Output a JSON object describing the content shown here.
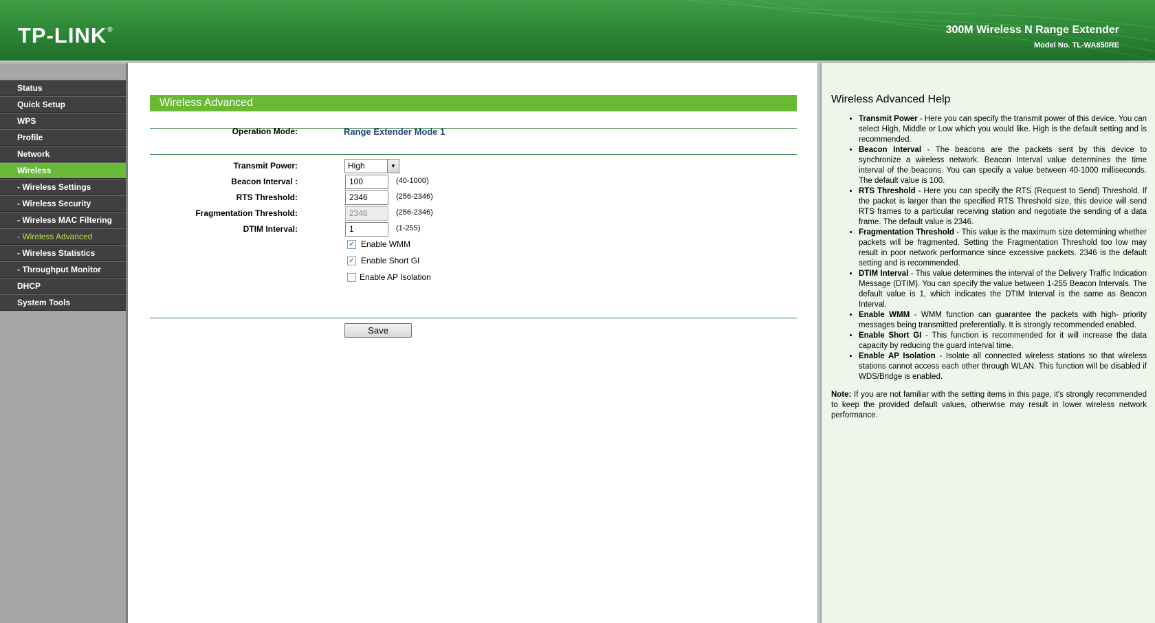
{
  "header": {
    "logo": "TP-LINK",
    "logo_mark": "®",
    "product_title": "300M Wireless N Range Extender",
    "model_no": "Model No. TL-WA850RE"
  },
  "sidebar": {
    "items": [
      {
        "label": "Status"
      },
      {
        "label": "Quick Setup"
      },
      {
        "label": "WPS"
      },
      {
        "label": "Profile"
      },
      {
        "label": "Network"
      },
      {
        "label": "Wireless"
      },
      {
        "label": "- Wireless Settings"
      },
      {
        "label": "- Wireless Security"
      },
      {
        "label": "- Wireless MAC Filtering"
      },
      {
        "label": "- Wireless Advanced"
      },
      {
        "label": "- Wireless Statistics"
      },
      {
        "label": "- Throughput Monitor"
      },
      {
        "label": "DHCP"
      },
      {
        "label": "System Tools"
      }
    ]
  },
  "main": {
    "section_title": "Wireless Advanced",
    "operation_mode": {
      "label": "Operation Mode:",
      "value": "Range Extender Mode 1"
    },
    "transmit_power": {
      "label": "Transmit Power:",
      "value": "High"
    },
    "beacon_interval": {
      "label": "Beacon Interval :",
      "value": "100",
      "hint": "(40-1000)"
    },
    "rts_threshold": {
      "label": "RTS Threshold:",
      "value": "2346",
      "hint": "(256-2346)"
    },
    "fragmentation_threshold": {
      "label": "Fragmentation Threshold:",
      "value": "2346",
      "hint": "(256-2346)"
    },
    "dtim_interval": {
      "label": "DTIM Interval:",
      "value": "1",
      "hint": "(1-255)"
    },
    "enable_wmm": {
      "label": "Enable WMM",
      "checked": true
    },
    "enable_short_gi": {
      "label": "Enable Short GI",
      "checked": true
    },
    "enable_ap_isolation": {
      "label": "Enable AP Isolation",
      "checked": false
    },
    "save_label": "Save"
  },
  "help": {
    "title": "Wireless Advanced Help",
    "items": [
      {
        "term": "Transmit Power",
        "text": " - Here you can specify the transmit power of this device. You can select High, Middle or Low which you would like. High is the default setting and is recommended."
      },
      {
        "term": "Beacon Interval",
        "text": " - The beacons are the packets sent by this device to synchronize a wireless network. Beacon Interval value determines the time interval of the beacons. You can specify a value between 40-1000 milliseconds. The default value is 100."
      },
      {
        "term": "RTS Threshold",
        "text": " - Here you can specify the RTS (Request to Send) Threshold. If the packet is larger than the specified RTS Threshold size, this device will send RTS frames to a particular receiving station and negotiate the sending of a data frame. The default value is 2346."
      },
      {
        "term": "Fragmentation Threshold",
        "text": " - This value is the maximum size determining whether packets will be fragmented. Setting the Fragmentation Threshold too low may result in poor network performance since excessive packets. 2346 is the default setting and is recommended."
      },
      {
        "term": "DTIM Interval",
        "text": " - This value determines the interval of the Delivery Traffic Indication Message (DTIM). You can specify the value between 1-255 Beacon Intervals. The default value is 1, which indicates the DTIM Interval is the same as Beacon Interval."
      },
      {
        "term": "Enable WMM",
        "text": " - WMM function can guarantee the packets with high- priority messages being transmitted preferentially. It is strongly recommended enabled."
      },
      {
        "term": "Enable Short GI",
        "text": " - This function is recommended for it will increase the data capacity by reducing the guard interval time."
      },
      {
        "term": "Enable AP Isolation",
        "text": " - Isolate all connected wireless stations so that wireless stations cannot access each other through WLAN. This function will be disabled if WDS/Bridge is enabled."
      }
    ],
    "note_label": "Note:",
    "note_text": " If you are not familiar with the setting items in this page, it's strongly recommended to keep the provided default values, otherwise may result in lower wireless network performance."
  },
  "colors": {
    "header_green": "#2f8a37",
    "accent_green": "#6ab935",
    "menu_dark": "#404040",
    "current_item": "#b7e04d",
    "value_blue": "#21437b",
    "help_bg": "#eef6ec"
  }
}
